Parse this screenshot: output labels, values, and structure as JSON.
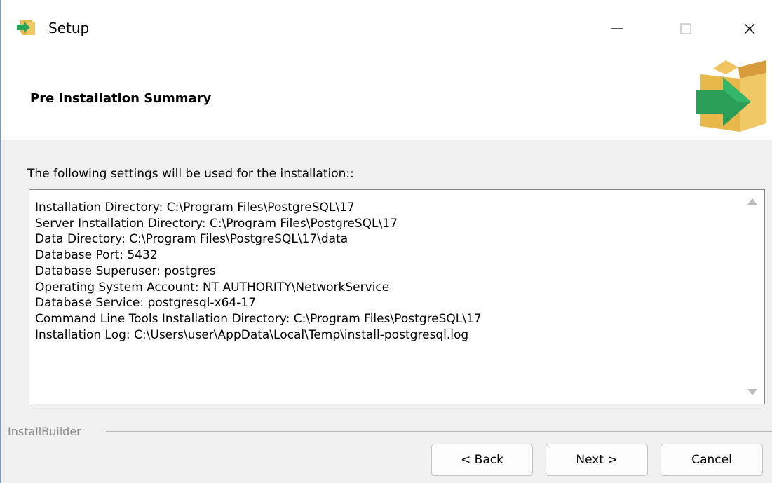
{
  "window": {
    "title": "Setup"
  },
  "header": {
    "title": "Pre Installation Summary"
  },
  "content": {
    "intro": "The following settings will be used for the installation::",
    "summary": [
      "Installation Directory: C:\\Program Files\\PostgreSQL\\17",
      "Server Installation Directory: C:\\Program Files\\PostgreSQL\\17",
      "Data Directory: C:\\Program Files\\PostgreSQL\\17\\data",
      "Database Port: 5432",
      "Database Superuser: postgres",
      "Operating System Account: NT AUTHORITY\\NetworkService",
      "Database Service: postgresql-x64-17",
      "Command Line Tools Installation Directory: C:\\Program Files\\PostgreSQL\\17",
      "Installation Log: C:\\Users\\user\\AppData\\Local\\Temp\\install-postgresql.log"
    ]
  },
  "footer": {
    "brand": "InstallBuilder",
    "back_label": "< Back",
    "next_label": "Next >",
    "cancel_label": "Cancel"
  },
  "icons": {
    "app": "setup-box-arrow-icon",
    "minimize": "minimize-icon",
    "maximize": "maximize-icon",
    "close": "close-icon",
    "header": "box-arrow-icon",
    "scroll_up": "scroll-up-arrow-icon",
    "scroll_down": "scroll-down-arrow-icon"
  },
  "colors": {
    "box": "#e8b84a",
    "arrow": "#27a35a",
    "title_bar": "#ffffff",
    "dialog": "#f0f0f0"
  }
}
